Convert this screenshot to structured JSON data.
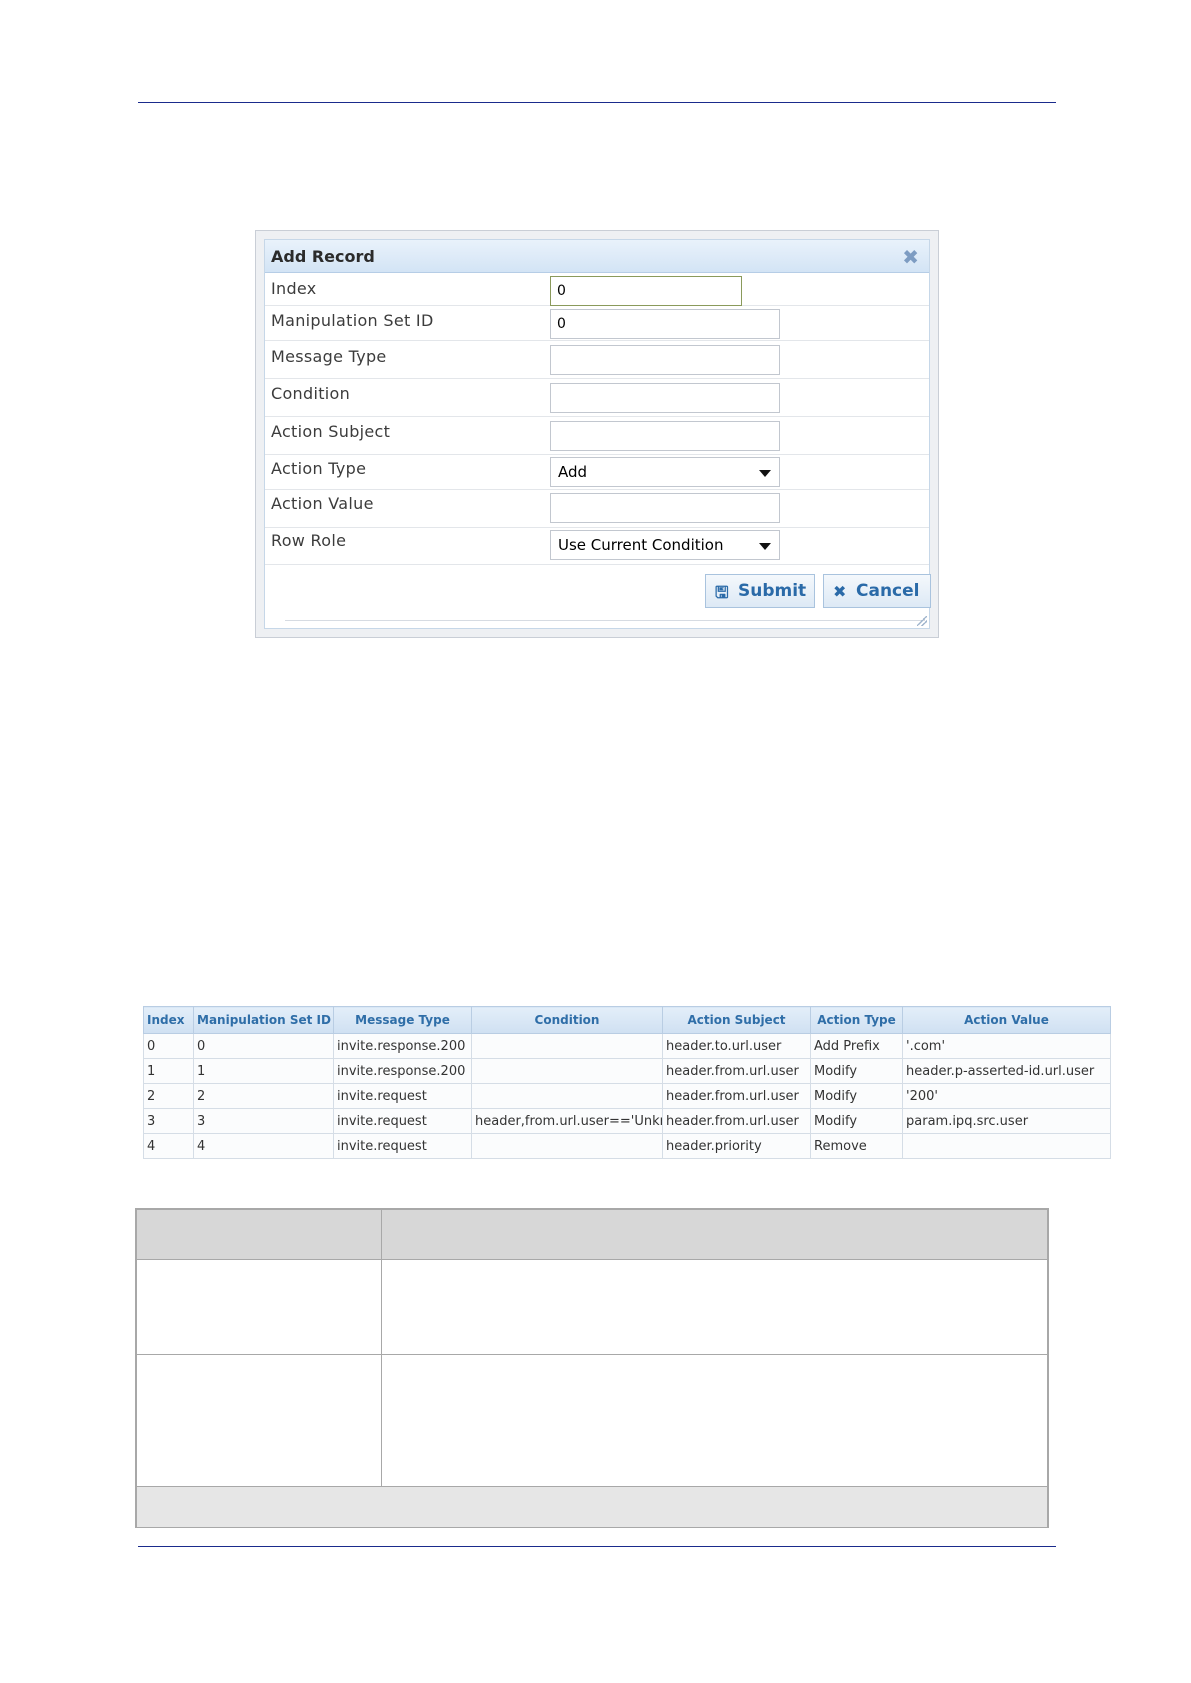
{
  "dialog": {
    "title": "Add Record",
    "fields": [
      {
        "label": "Index",
        "value": "0"
      },
      {
        "label": "Manipulation Set ID",
        "value": "0"
      },
      {
        "label": "Message Type",
        "value": ""
      },
      {
        "label": "Condition",
        "value": ""
      },
      {
        "label": "Action Subject",
        "value": ""
      },
      {
        "label": "Action Type",
        "value": "Add"
      },
      {
        "label": "Action Value",
        "value": ""
      },
      {
        "label": "Row Role",
        "value": "Use Current Condition"
      }
    ],
    "submit_label": "Submit",
    "cancel_label": "Cancel"
  },
  "table": {
    "columns": [
      "Index",
      "Manipulation Set ID",
      "Message Type",
      "Condition",
      "Action Subject",
      "Action Type",
      "Action Value"
    ],
    "rows": [
      [
        "0",
        "0",
        "invite.response.200",
        "",
        "header.to.url.user",
        "Add Prefix",
        "'.com'"
      ],
      [
        "1",
        "1",
        "invite.response.200",
        "",
        "header.from.url.user",
        "Modify",
        "header.p-asserted-id.url.user"
      ],
      [
        "2",
        "2",
        "invite.request",
        "",
        "header.from.url.user",
        "Modify",
        "'200'"
      ],
      [
        "3",
        "3",
        "invite.request",
        "header,from.url.user=='Unkr",
        "header.from.url.user",
        "Modify",
        "param.ipq.src.user"
      ],
      [
        "4",
        "4",
        "invite.request",
        "",
        "header.priority",
        "Remove",
        ""
      ]
    ]
  }
}
